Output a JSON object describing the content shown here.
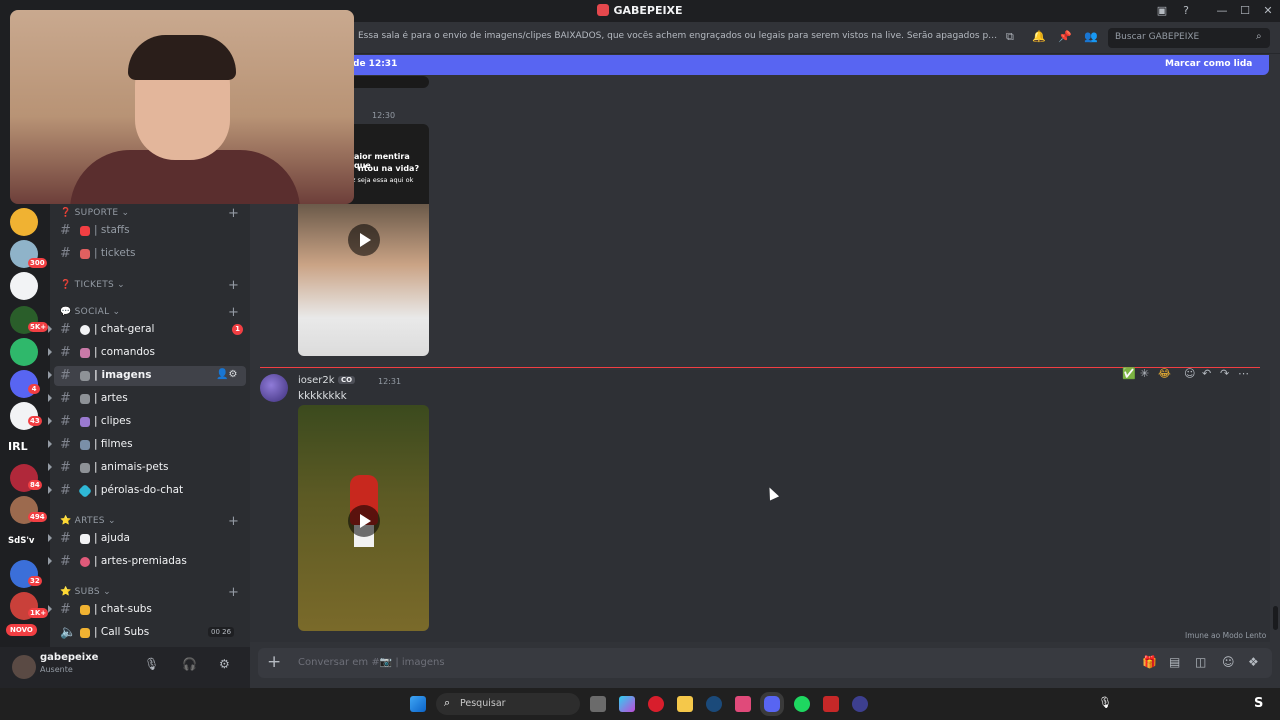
{
  "window": {
    "title": "GABEPEIXE"
  },
  "header": {
    "topic": "Essa sala é para o envio de imagens/clipes BAIXADOS, que vocês achem engraçados ou legais para serem vistos na live. Serão apagados prints de outras rede...",
    "search_placeholder": "Buscar GABEPEIXE"
  },
  "new_messages_bar": {
    "since": "de 12:31",
    "mark_read": "Marcar como lida"
  },
  "servers": {
    "badges": [
      "5K+",
      "4",
      "43",
      "84",
      "494",
      "32",
      "1K+"
    ],
    "text_items": [
      "IRL",
      "SdS'v"
    ],
    "badge_300": "300",
    "novo": "NOVO"
  },
  "categories": {
    "suporte": "SUPORTE",
    "tickets": "TICKETS",
    "social": "SOCIAL",
    "artes": "ARTES",
    "subs": "SUBS"
  },
  "channels": {
    "staffs": "| staffs",
    "tickets": "| tickets",
    "chat_geral": "| chat-geral",
    "chat_geral_mentions": "1",
    "comandos": "| comandos",
    "imagens": "| imagens",
    "artes": "| artes",
    "clipes": "| clipes",
    "filmes": "| filmes",
    "animais_pets": "| animais-pets",
    "perolas": "| pérolas-do-chat",
    "ajuda": "| ajuda",
    "artes_premiadas": "| artes-premiadas",
    "chat_subs": "| chat-subs",
    "call_subs": "| Call Subs",
    "call_subs_count_a": "00",
    "call_subs_count_b": "26"
  },
  "user": {
    "name": "gabepeixe",
    "status": "Ausente"
  },
  "messages": [
    {
      "time": "12:30",
      "video_caption_line1": "aior mentira que",
      "video_caption_line2": "ntou na vida?",
      "video_caption_line3": "z seja essa aqui ok"
    },
    {
      "author": "ioser2k",
      "tag": "CO",
      "time": "12:31",
      "text": "kkkkkkkk"
    }
  ],
  "slowmode_note": "Imune ao Modo Lento",
  "composer": {
    "placeholder": "Conversar em #📷 | imagens"
  },
  "taskbar": {
    "search_placeholder": "Pesquisar"
  },
  "colors": {
    "blurple": "#5865f2",
    "red": "#f23f43",
    "bg": "#313338",
    "sidebar": "#2b2d31",
    "rail": "#1e1f22"
  }
}
